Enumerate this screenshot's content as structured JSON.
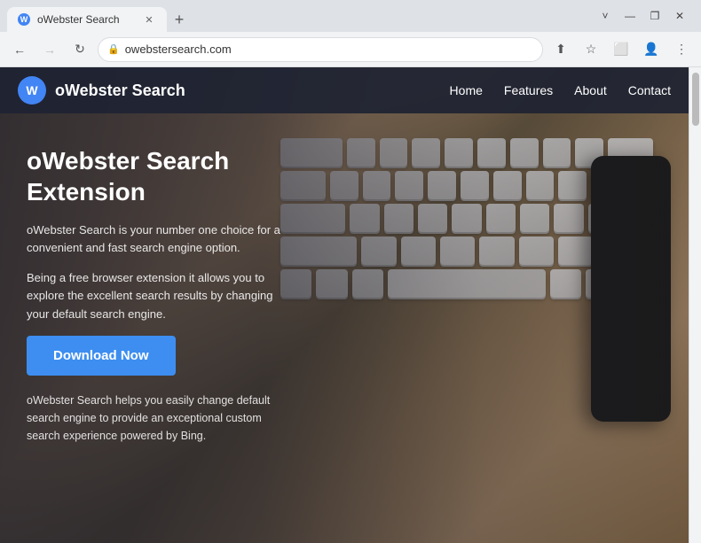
{
  "browser": {
    "tab_title": "oWebster Search",
    "tab_favicon_label": "W",
    "new_tab_icon": "+",
    "window_controls": {
      "minimize": "—",
      "maximize": "❐",
      "close": "✕",
      "chevron": "˅"
    },
    "nav_back": "←",
    "nav_forward": "→",
    "nav_reload": "↻",
    "address": "owebstersearch.com",
    "lock_icon": "🔒"
  },
  "nav_links": {
    "home": "Home",
    "features": "Features",
    "about": "About",
    "contact": "Contact"
  },
  "logo": {
    "icon_label": "W",
    "text": "oWebster Search"
  },
  "hero": {
    "title": "oWebster Search Extension",
    "desc1": "oWebster Search is your number one choice for a convenient and fast search engine option.",
    "desc2": "Being a free browser extension it allows you to explore the excellent search results by changing your default search engine.",
    "download_btn": "Download Now",
    "footer_text": "oWebster Search helps you easily change default search engine to provide an exceptional custom search experience powered by Bing."
  }
}
